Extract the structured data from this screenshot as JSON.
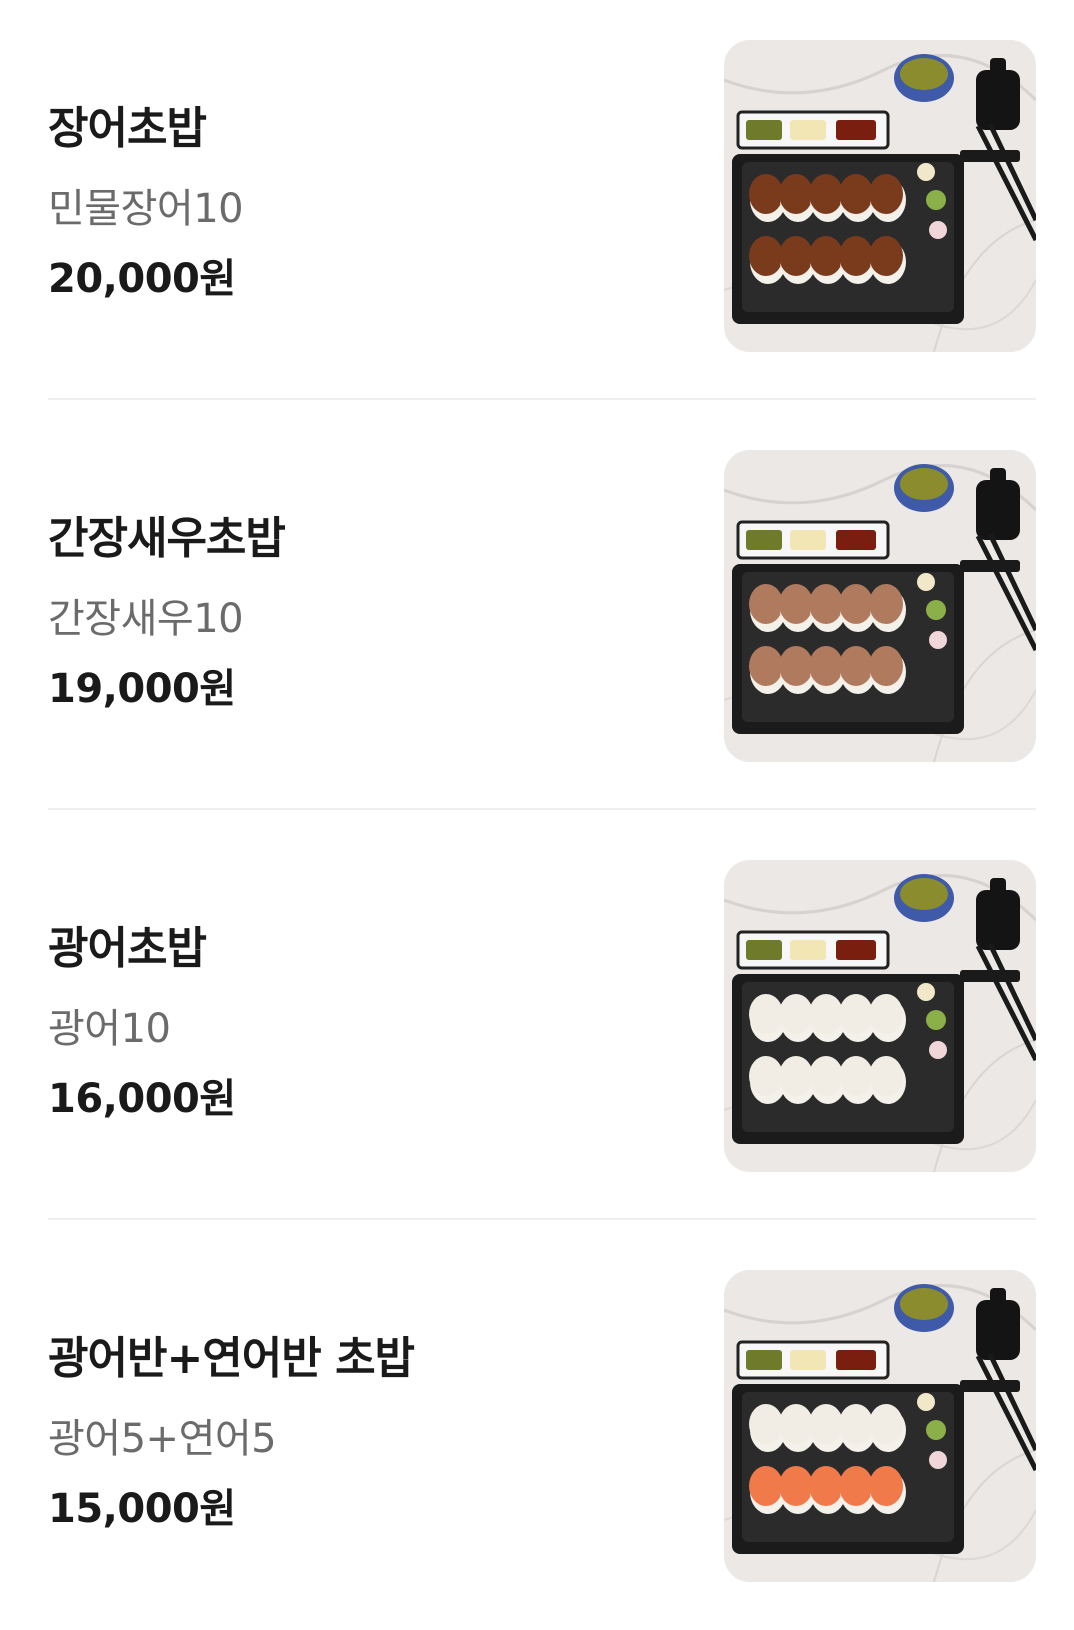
{
  "menu": {
    "items": [
      {
        "name": "장어초밥",
        "description": "민물장어10",
        "price": "20,000원",
        "image_icon": "eel-sushi-platter-image",
        "top_row_color": "#7a3a1c",
        "bottom_row_color": "#7a3a1c"
      },
      {
        "name": "간장새우초밥",
        "description": "간장새우10",
        "price": "19,000원",
        "image_icon": "soy-shrimp-sushi-platter-image",
        "top_row_color": "#b07a5e",
        "bottom_row_color": "#b07a5e"
      },
      {
        "name": "광어초밥",
        "description": "광어10",
        "price": "16,000원",
        "image_icon": "flatfish-sushi-platter-image",
        "top_row_color": "#f1ede4",
        "bottom_row_color": "#f1ede4"
      },
      {
        "name": "광어반+연어반 초밥",
        "description": "광어5+연어5",
        "price": "15,000원",
        "image_icon": "flatfish-salmon-sushi-platter-image",
        "top_row_color": "#f1ede4",
        "bottom_row_color": "#f07a4a"
      }
    ]
  }
}
